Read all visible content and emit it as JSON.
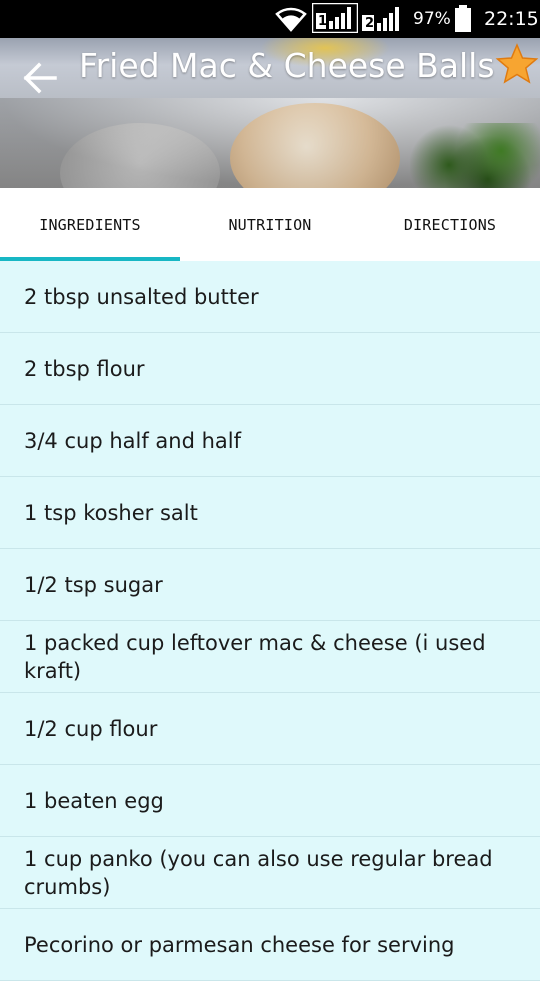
{
  "status_bar": {
    "battery": "97%",
    "time": "22:15",
    "sim1_label": "1",
    "sim2_label": "2",
    "icons": [
      "wifi-icon",
      "sim1-signal-icon",
      "sim2-signal-icon",
      "battery-icon"
    ]
  },
  "header": {
    "title": "Fried Mac & Cheese Balls",
    "back_icon": "arrow-left-icon",
    "favorite_icon": "star-icon",
    "colors": {
      "star": "#f7a531",
      "title": "#ffffff"
    }
  },
  "tabs": [
    {
      "label": "INGREDIENTS",
      "active": true
    },
    {
      "label": "NUTRITION",
      "active": false
    },
    {
      "label": "DIRECTIONS",
      "active": false
    }
  ],
  "tab_indicator_color": "#17b7c4",
  "ingredients": [
    "2 tbsp unsalted butter",
    "2 tbsp flour",
    "3/4 cup half and half",
    "1 tsp kosher salt",
    "1/2 tsp sugar",
    "1 packed cup leftover mac & cheese (i used kraft)",
    "1/2 cup flour",
    "1 beaten egg",
    "1 cup panko (you can also use regular bread crumbs)",
    "Pecorino or parmesan cheese for serving"
  ]
}
